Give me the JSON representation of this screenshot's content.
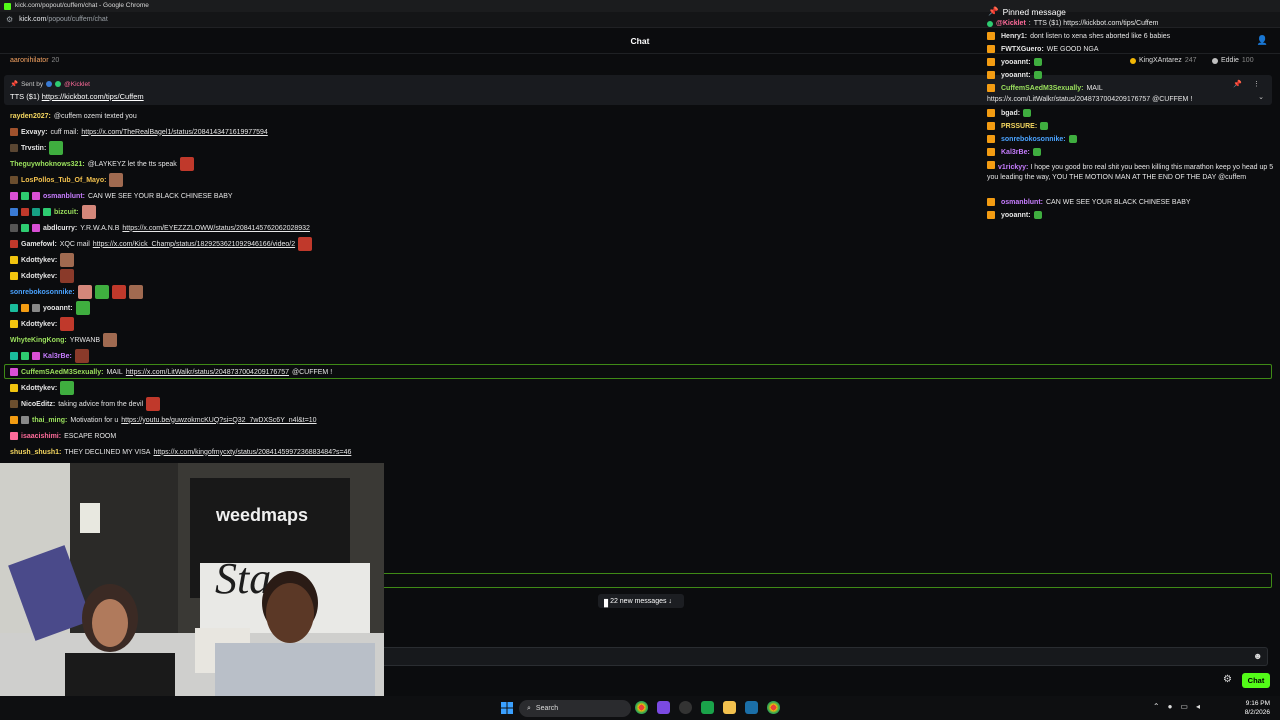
{
  "browser": {
    "window_title": "kick.com/popout/cuffem/chat - Google Chrome",
    "url_host": "kick.com",
    "url_path": "/popout/cuffem/chat"
  },
  "header": {
    "title": "Chat"
  },
  "top_row": {
    "user": "aaronihilator",
    "count": "20",
    "leaders": [
      {
        "name": "KingXAntarez",
        "points": "247",
        "color": "#f2b705"
      },
      {
        "name": "Eddie",
        "points": "100",
        "color": "#c0c0c0"
      }
    ]
  },
  "pinned_banner": {
    "sent_by": "Sent by",
    "sender": "@Kicklet",
    "text": "TTS ($1)",
    "link": "https://kickbot.com/tips/Cuffem"
  },
  "messages": [
    {
      "user": "rayden2027",
      "color": "#f6d860",
      "text": "@cuffem ozemi texted you",
      "badges": [],
      "emotes": 0
    },
    {
      "user": "Exvayy",
      "color": "#e6e6e6",
      "text": "cuff mail:",
      "link": "https://x.com/TheRealBagel1/status/2084143471619977594",
      "badges": [
        "#a0522d"
      ],
      "emotes": 0
    },
    {
      "user": "Trvstin",
      "color": "#e6e6e6",
      "text": "",
      "badges": [
        "#5a4632"
      ],
      "emotes": 1
    },
    {
      "user": "Theguywhoknows321",
      "color": "#9be15d",
      "text": "@LAYKEYZ let the tts speak",
      "badges": [],
      "emotes": 1
    },
    {
      "user": "LosPollos_Tub_Of_Mayo",
      "color": "#f2c14e",
      "text": "",
      "badges": [
        "#6b4e2e"
      ],
      "emotes": 1
    },
    {
      "user": "osmanblunt",
      "color": "#c77dff",
      "text": "CAN WE SEE YOUR BLACK CHINESE BABY",
      "badges": [
        "#d94fd5",
        "#2ecc71",
        "#d94fd5"
      ],
      "emotes": 0
    },
    {
      "user": "bizcuit",
      "color": "#9be15d",
      "text": "",
      "badges": [
        "#3a7bd5",
        "#c0392b",
        "#16a085",
        "#2ecc71"
      ],
      "emotes": 1
    },
    {
      "user": "abdlcurry",
      "color": "#e6e6e6",
      "text": "Y.R.W.A.N.B",
      "link": "https://x.com/EYEZZZLOWW/status/2084145762062028932",
      "badges": [
        "#555",
        "#2ecc71",
        "#d94fd5"
      ],
      "emotes": 0
    },
    {
      "user": "Gamefowl",
      "color": "#e6e6e6",
      "text": "XQC mail",
      "link": "https://x.com/Kick_Champ/status/1829253621092946166/video/2",
      "badges": [
        "#c0392b"
      ],
      "emotes": 1
    },
    {
      "user": "Kdottykev",
      "color": "#e6e6e6",
      "text": "",
      "badges": [
        "#f1c40f"
      ],
      "emotes": 1
    },
    {
      "user": "Kdottykev",
      "color": "#e6e6e6",
      "text": "",
      "badges": [
        "#f1c40f"
      ],
      "emotes": 1
    },
    {
      "user": "sonrebokosonnike",
      "color": "#4aa3ff",
      "text": "",
      "badges": [],
      "emotes": 4
    },
    {
      "user": "yooannt",
      "color": "#e6e6e6",
      "text": "",
      "badges": [
        "#1abc9c",
        "#f39c12",
        "#888"
      ],
      "emotes": 1
    },
    {
      "user": "Kdottykev",
      "color": "#e6e6e6",
      "text": "",
      "badges": [
        "#f1c40f"
      ],
      "emotes": 1
    },
    {
      "user": "WhyteKingKong",
      "color": "#9be15d",
      "text": "YRWANB",
      "badges": [],
      "emotes": 1
    },
    {
      "user": "Kal3rBe",
      "color": "#c77dff",
      "text": "",
      "badges": [
        "#1abc9c",
        "#2ecc71",
        "#d94fd5"
      ],
      "emotes": 1
    },
    {
      "user": "CuffemSAedM3Sexually",
      "color": "#9be15d",
      "text": "MAIL",
      "link": "https://x.com/LitWalkr/status/2048737004209176757",
      "suffix": "@CUFFEM !",
      "badges": [
        "#d94fd5"
      ],
      "emotes": 0
    },
    {
      "user": "Kdottykev",
      "color": "#e6e6e6",
      "text": "",
      "badges": [
        "#f1c40f"
      ],
      "emotes": 1
    },
    {
      "user": "NicoEditz",
      "color": "#e6e6e6",
      "text": "taking advice from the devil",
      "badges": [
        "#6b4e2e"
      ],
      "emotes": 1
    },
    {
      "user": "thai_ming",
      "color": "#9be15d",
      "text": "Motivation for u",
      "link": "https://youtu.be/guwzokmcKUQ?si=Q32_7wDXSc6Y_n4l&t=10",
      "badges": [
        "#f39c12",
        "#888"
      ],
      "emotes": 0
    },
    {
      "user": "isaacishimi",
      "color": "#ff6b9a",
      "text": "ESCAPE ROOM",
      "badges": [
        "#ff6b9a"
      ],
      "emotes": 0
    },
    {
      "user": "shush_shush1",
      "color": "#f6d860",
      "text": "THEY DECLINED MY VISA",
      "link": "https://x.com/kingofmycxty/status/2084145997236883484?s=46",
      "badges": [],
      "emotes": 0
    }
  ],
  "right_panel": {
    "title": "Pinned message",
    "pinned": {
      "user": "@Kicklet",
      "text": "TTS ($1) https://kickbot.com/tips/Cuffem"
    },
    "rows": [
      {
        "user": "Henry1",
        "color": "#e6e6e6",
        "text": "dont listen to xena shes aborted like 6 babies"
      },
      {
        "user": "FWTXGuero",
        "color": "#e6e6e6",
        "text": "WE GOOD NGA"
      },
      {
        "user": "yooannt",
        "color": "#e6e6e6",
        "text": ""
      },
      {
        "user": "yooannt",
        "color": "#e6e6e6",
        "text": ""
      },
      {
        "user": "CuffemSAedM3Sexually",
        "color": "#9be15d",
        "text": "MAIL"
      },
      {
        "user": "bgad",
        "color": "#e6e6e6",
        "text": ""
      },
      {
        "user": "PRSSURE",
        "color": "#f6d860",
        "text": ""
      },
      {
        "user": "sonrebokosonnike",
        "color": "#4aa3ff",
        "text": ""
      },
      {
        "user": "Kal3rBe",
        "color": "#c77dff",
        "text": ""
      },
      {
        "user": "v1rickyy",
        "color": "#c77dff",
        "text": "I hope you good bro real shit you been killing this marathon keep yo head up 5 you leading the way, YOU THE MOTION MAN AT THE END OF THE DAY @cuffem"
      },
      {
        "user": "osmanblunt",
        "color": "#c77dff",
        "text": "CAN WE SEE YOUR BLACK CHINESE BABY"
      },
      {
        "user": "yooannt",
        "color": "#e6e6e6",
        "text": ""
      }
    ],
    "mail_link": "https://x.com/LitWalkr/status/2048737004209176757 @CUFFEM !"
  },
  "webcam": {
    "sign_text": "weedmaps",
    "sign_big": "Sta"
  },
  "new_messages": {
    "label": "22 new messages ↓"
  },
  "input": {
    "chat_button": "Chat"
  },
  "taskbar": {
    "search_placeholder": "Search",
    "time": "9:16 PM",
    "date": "8/2/2026"
  }
}
